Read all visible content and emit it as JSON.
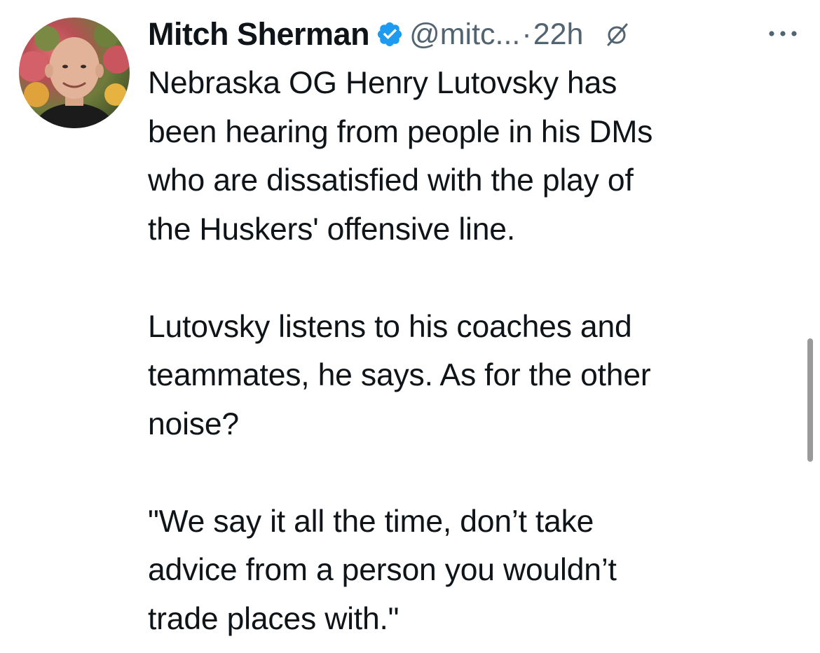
{
  "tweet": {
    "author": {
      "name": "Mitch Sherman",
      "handle": "@mitc...",
      "verified": true,
      "verified_icon": "verified-badge-icon",
      "avatar_icon": "avatar-photo"
    },
    "separator": "·",
    "timestamp": "22h",
    "grok_icon": "grok-slash-circle-icon",
    "more_icon": "more-horizontal-icon",
    "paragraphs": [
      {
        "lines": [
          "Nebraska OG Henry Lutovsky has",
          "been hearing from people in his DMs",
          "who are dissatisfied with the play of",
          "the Huskers' offensive line."
        ]
      },
      {
        "lines": [
          "Lutovsky listens to his coaches and",
          "teammates, he says. As for the other",
          "noise?"
        ]
      },
      {
        "lines": [
          "\"We say it all the time, don’t take",
          "advice from a person you wouldn’t",
          "trade places with.\""
        ]
      }
    ]
  },
  "colors": {
    "text_primary": "#0f1419",
    "text_secondary": "#536471",
    "verified_blue": "#1d9bf0",
    "scrollbar": "#9a9a9a",
    "background": "#ffffff"
  }
}
